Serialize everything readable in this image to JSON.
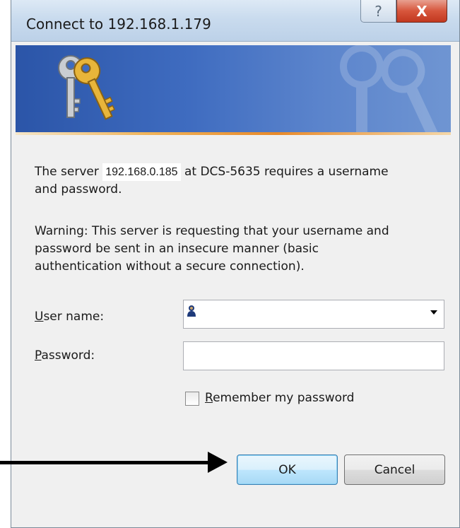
{
  "window": {
    "title": "Connect to 192.168.1.179",
    "help_label": "?",
    "close_label": "X"
  },
  "message": {
    "prefix": "The server ",
    "server_ip": "192.168.0.185",
    "suffix_line1": " at DCS-5635 requires a username",
    "line2": "and password.",
    "warning_line1": "Warning: This server is requesting that your username and",
    "warning_line2": "password be sent in an insecure manner (basic",
    "warning_line3": "authentication without a secure connection)."
  },
  "form": {
    "username_label_mnemonic": "U",
    "username_label_rest": "ser name:",
    "username_value": "",
    "password_label_mnemonic": "P",
    "password_label_rest": "assword:",
    "password_value": "",
    "remember_mnemonic": "R",
    "remember_rest": "emember my password",
    "remember_checked": false
  },
  "buttons": {
    "ok": "OK",
    "cancel": "Cancel"
  },
  "icons": {
    "banner": "keys-icon",
    "username": "user-icon",
    "dropdown": "chevron-down-icon",
    "annotation": "arrow-right-icon"
  },
  "colors": {
    "banner_blue": "#2b55a8",
    "banner_accent": "#e88a2a",
    "close_red": "#c2381f",
    "ok_border": "#3c7fb1"
  }
}
